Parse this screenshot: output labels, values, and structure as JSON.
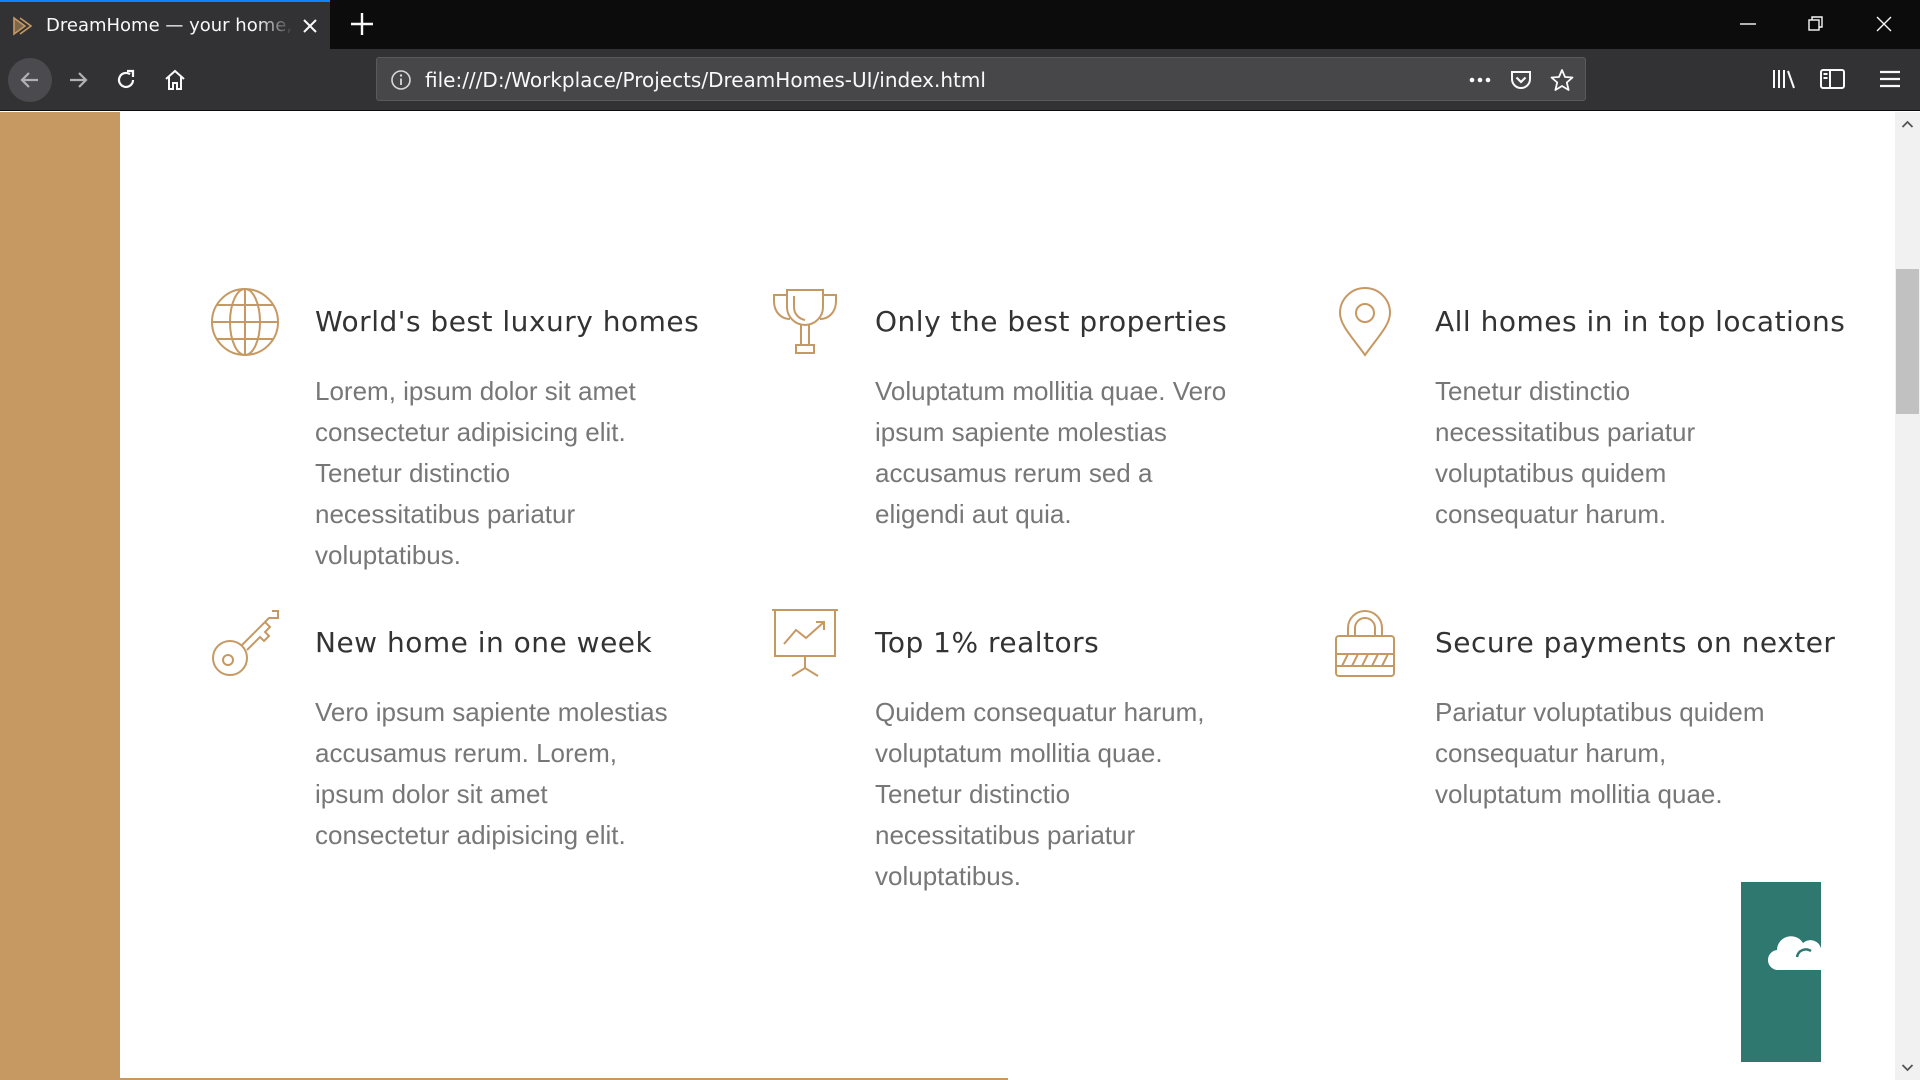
{
  "browser": {
    "tab_title": "DreamHome — your home, your dream",
    "url": "file:///D:/Workplace/Projects/DreamHomes-UI/index.html"
  },
  "colors": {
    "primary": "#c69963",
    "accent_widget": "#2e7870",
    "heading": "#333333",
    "body_text": "#777777"
  },
  "features": [
    {
      "icon": "globe-icon",
      "title": "World's best luxury homes",
      "text": "Lorem, ipsum dolor sit amet consectetur adipisicing elit. Tenetur distinctio necessitatibus pariatur voluptatibus."
    },
    {
      "icon": "trophy-icon",
      "title": "Only the best properties",
      "text": "Voluptatum mollitia quae. Vero ipsum sapiente molestias accusamus rerum sed a eligendi aut quia."
    },
    {
      "icon": "map-pin-icon",
      "title": "All homes in in top locations",
      "text": "Tenetur distinctio necessitatibus pariatur voluptatibus quidem consequatur harum."
    },
    {
      "icon": "key-icon",
      "title": "New home in one week",
      "text": "Vero ipsum sapiente molestias accusamus rerum. Lorem, ipsum dolor sit amet consectetur adipisicing elit."
    },
    {
      "icon": "presentation-chart-icon",
      "title": "Top 1% realtors",
      "text": "Quidem consequatur harum, voluptatum mollitia quae. Tenetur distinctio necessitatibus pariatur voluptatibus."
    },
    {
      "icon": "padlock-icon",
      "title": "Secure payments on nexter",
      "text": "Pariatur voluptatibus quidem consequatur harum, voluptatum mollitia quae."
    }
  ]
}
